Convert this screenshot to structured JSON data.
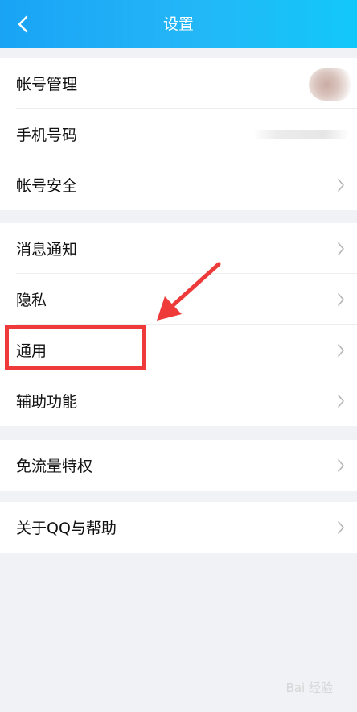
{
  "header": {
    "title": "设置",
    "back_icon": "chevron-left-icon"
  },
  "groups": [
    {
      "items": [
        {
          "label": "帐号管理"
        },
        {
          "label": "手机号码"
        },
        {
          "label": "帐号安全"
        }
      ]
    },
    {
      "items": [
        {
          "label": "消息通知"
        },
        {
          "label": "隐私"
        },
        {
          "label": "通用"
        },
        {
          "label": "辅助功能"
        }
      ]
    },
    {
      "items": [
        {
          "label": "免流量特权"
        }
      ]
    },
    {
      "items": [
        {
          "label": "关于QQ与帮助"
        }
      ]
    }
  ],
  "annotation": {
    "highlight_color": "#ef3a3a"
  },
  "watermark": {
    "text": "Bai 经验"
  },
  "colors": {
    "header_start": "#1aa3f5",
    "header_end": "#12c8fa",
    "background": "#f1f2f6"
  }
}
